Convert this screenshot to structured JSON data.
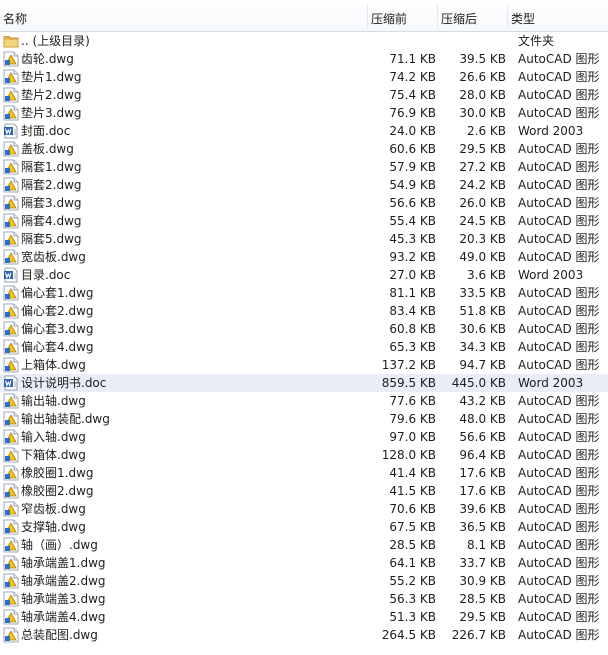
{
  "columns": {
    "name": "名称",
    "compressed": "压缩前",
    "size": "压缩后",
    "type": "类型"
  },
  "files": [
    {
      "name": ".. (上级目录)",
      "compressed": "",
      "size": "",
      "type": "文件夹",
      "icon": "folder-icon"
    },
    {
      "name": "齿轮.dwg",
      "compressed": "71.1 KB",
      "size": "39.5 KB",
      "type": "AutoCAD 图形",
      "icon": "dwg-file-icon"
    },
    {
      "name": "垫片1.dwg",
      "compressed": "74.2 KB",
      "size": "26.6 KB",
      "type": "AutoCAD 图形",
      "icon": "dwg-file-icon"
    },
    {
      "name": "垫片2.dwg",
      "compressed": "75.4 KB",
      "size": "28.0 KB",
      "type": "AutoCAD 图形",
      "icon": "dwg-file-icon"
    },
    {
      "name": "垫片3.dwg",
      "compressed": "76.9 KB",
      "size": "30.0 KB",
      "type": "AutoCAD 图形",
      "icon": "dwg-file-icon"
    },
    {
      "name": "封面.doc",
      "compressed": "24.0 KB",
      "size": "2.6 KB",
      "type": "Word 2003",
      "icon": "word-file-icon"
    },
    {
      "name": "盖板.dwg",
      "compressed": "60.6 KB",
      "size": "29.5 KB",
      "type": "AutoCAD 图形",
      "icon": "dwg-file-icon"
    },
    {
      "name": "隔套1.dwg",
      "compressed": "57.9 KB",
      "size": "27.2 KB",
      "type": "AutoCAD 图形",
      "icon": "dwg-file-icon"
    },
    {
      "name": "隔套2.dwg",
      "compressed": "54.9 KB",
      "size": "24.2 KB",
      "type": "AutoCAD 图形",
      "icon": "dwg-file-icon"
    },
    {
      "name": "隔套3.dwg",
      "compressed": "56.6 KB",
      "size": "26.0 KB",
      "type": "AutoCAD 图形",
      "icon": "dwg-file-icon"
    },
    {
      "name": "隔套4.dwg",
      "compressed": "55.4 KB",
      "size": "24.5 KB",
      "type": "AutoCAD 图形",
      "icon": "dwg-file-icon"
    },
    {
      "name": "隔套5.dwg",
      "compressed": "45.3 KB",
      "size": "20.3 KB",
      "type": "AutoCAD 图形",
      "icon": "dwg-file-icon"
    },
    {
      "name": "宽齿板.dwg",
      "compressed": "93.2 KB",
      "size": "49.0 KB",
      "type": "AutoCAD 图形",
      "icon": "dwg-file-icon"
    },
    {
      "name": "目录.doc",
      "compressed": "27.0 KB",
      "size": "3.6 KB",
      "type": "Word 2003",
      "icon": "word-file-icon"
    },
    {
      "name": "偏心套1.dwg",
      "compressed": "81.1 KB",
      "size": "33.5 KB",
      "type": "AutoCAD 图形",
      "icon": "dwg-file-icon"
    },
    {
      "name": "偏心套2.dwg",
      "compressed": "83.4 KB",
      "size": "51.8 KB",
      "type": "AutoCAD 图形",
      "icon": "dwg-file-icon"
    },
    {
      "name": "偏心套3.dwg",
      "compressed": "60.8 KB",
      "size": "30.6 KB",
      "type": "AutoCAD 图形",
      "icon": "dwg-file-icon"
    },
    {
      "name": "偏心套4.dwg",
      "compressed": "65.3 KB",
      "size": "34.3 KB",
      "type": "AutoCAD 图形",
      "icon": "dwg-file-icon"
    },
    {
      "name": "上箱体.dwg",
      "compressed": "137.2 KB",
      "size": "94.7 KB",
      "type": "AutoCAD 图形",
      "icon": "dwg-file-icon"
    },
    {
      "name": "设计说明书.doc",
      "compressed": "859.5 KB",
      "size": "445.0 KB",
      "type": "Word 2003",
      "icon": "word-file-icon",
      "selected": true
    },
    {
      "name": "输出轴.dwg",
      "compressed": "77.6 KB",
      "size": "43.2 KB",
      "type": "AutoCAD 图形",
      "icon": "dwg-file-icon"
    },
    {
      "name": "输出轴装配.dwg",
      "compressed": "79.6 KB",
      "size": "48.0 KB",
      "type": "AutoCAD 图形",
      "icon": "dwg-file-icon"
    },
    {
      "name": "输入轴.dwg",
      "compressed": "97.0 KB",
      "size": "56.6 KB",
      "type": "AutoCAD 图形",
      "icon": "dwg-file-icon"
    },
    {
      "name": "下箱体.dwg",
      "compressed": "128.0 KB",
      "size": "96.4 KB",
      "type": "AutoCAD 图形",
      "icon": "dwg-file-icon"
    },
    {
      "name": "橡胶圈1.dwg",
      "compressed": "41.4 KB",
      "size": "17.6 KB",
      "type": "AutoCAD 图形",
      "icon": "dwg-file-icon"
    },
    {
      "name": "橡胶圈2.dwg",
      "compressed": "41.5 KB",
      "size": "17.6 KB",
      "type": "AutoCAD 图形",
      "icon": "dwg-file-icon"
    },
    {
      "name": "窄齿板.dwg",
      "compressed": "70.6 KB",
      "size": "39.6 KB",
      "type": "AutoCAD 图形",
      "icon": "dwg-file-icon"
    },
    {
      "name": "支撑轴.dwg",
      "compressed": "67.5 KB",
      "size": "36.5 KB",
      "type": "AutoCAD 图形",
      "icon": "dwg-file-icon"
    },
    {
      "name": "轴（画）.dwg",
      "compressed": "28.5 KB",
      "size": "8.1 KB",
      "type": "AutoCAD 图形",
      "icon": "dwg-file-icon"
    },
    {
      "name": "轴承端盖1.dwg",
      "compressed": "64.1 KB",
      "size": "33.7 KB",
      "type": "AutoCAD 图形",
      "icon": "dwg-file-icon"
    },
    {
      "name": "轴承端盖2.dwg",
      "compressed": "55.2 KB",
      "size": "30.9 KB",
      "type": "AutoCAD 图形",
      "icon": "dwg-file-icon"
    },
    {
      "name": "轴承端盖3.dwg",
      "compressed": "56.3 KB",
      "size": "28.5 KB",
      "type": "AutoCAD 图形",
      "icon": "dwg-file-icon"
    },
    {
      "name": "轴承端盖4.dwg",
      "compressed": "51.3 KB",
      "size": "29.5 KB",
      "type": "AutoCAD 图形",
      "icon": "dwg-file-icon"
    },
    {
      "name": "总装配图.dwg",
      "compressed": "264.5 KB",
      "size": "226.7 KB",
      "type": "AutoCAD 图形",
      "icon": "dwg-file-icon"
    }
  ]
}
